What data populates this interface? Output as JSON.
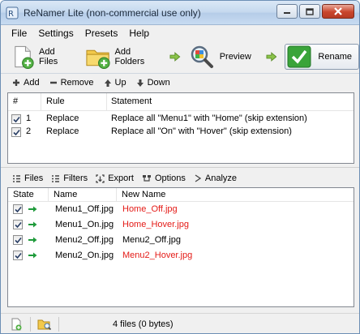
{
  "window": {
    "title": "ReNamer Lite (non-commercial use only)"
  },
  "menubar": [
    "File",
    "Settings",
    "Presets",
    "Help"
  ],
  "toolbar": {
    "add_files": "Add Files",
    "add_folders": "Add Folders",
    "preview": "Preview",
    "rename": "Rename"
  },
  "rules_toolbar": {
    "add": "Add",
    "remove": "Remove",
    "up": "Up",
    "down": "Down"
  },
  "rules": {
    "headers": {
      "num": "#",
      "rule": "Rule",
      "statement": "Statement"
    },
    "rows": [
      {
        "num": "1",
        "rule": "Replace",
        "statement": "Replace all \"Menu1\" with \"Home\" (skip extension)",
        "checked": true
      },
      {
        "num": "2",
        "rule": "Replace",
        "statement": "Replace all \"On\" with \"Hover\" (skip extension)",
        "checked": true
      }
    ]
  },
  "files_toolbar": {
    "files": "Files",
    "filters": "Filters",
    "export": "Export",
    "options": "Options",
    "analyze": "Analyze"
  },
  "files": {
    "headers": {
      "state": "State",
      "name": "Name",
      "new_name": "New Name"
    },
    "rows": [
      {
        "name": "Menu1_Off.jpg",
        "new_name": "Home_Off.jpg",
        "changed": true,
        "checked": true
      },
      {
        "name": "Menu1_On.jpg",
        "new_name": "Home_Hover.jpg",
        "changed": true,
        "checked": true
      },
      {
        "name": "Menu2_Off.jpg",
        "new_name": "Menu2_Off.jpg",
        "changed": false,
        "checked": true
      },
      {
        "name": "Menu2_On.jpg",
        "new_name": "Menu2_Hover.jpg",
        "changed": true,
        "checked": true
      }
    ]
  },
  "status": {
    "text": "4 files (0 bytes)"
  },
  "colors": {
    "changed_name": "#e41b17",
    "arrow_green": "#1e9a3a",
    "rename_check": "#3aa43a"
  }
}
